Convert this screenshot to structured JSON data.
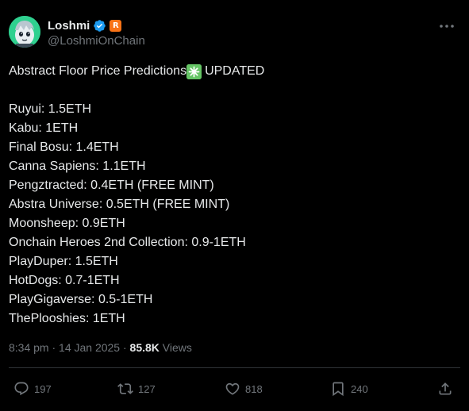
{
  "user": {
    "display_name": "Loshmi",
    "handle": "@LoshmiOnChain",
    "affiliate_letter": "R"
  },
  "post": {
    "headline_before": "Abstract Floor Price Predictions",
    "headline_after": "UPDATED",
    "lines": [
      "Ruyui: 1.5ETH",
      "Kabu: 1ETH",
      "Final Bosu: 1.4ETH",
      "Canna Sapiens: 1.1ETH",
      "Pengztracted: 0.4ETH (FREE MINT)",
      "Abstra Universe: 0.5ETH (FREE MINT)",
      "Moonsheep: 0.9ETH",
      "Onchain Heroes 2nd Collection: 0.9-1ETH",
      "PlayDuper: 1.5ETH",
      "HotDogs: 0.7-1ETH",
      "PlayGigaverse: 0.5-1ETH",
      "ThePlooshies: 1ETH"
    ],
    "timestamp": "8:34 pm · 14 Jan 2025 · ",
    "views_count": "85.8K",
    "views_label": "Views"
  },
  "actions": {
    "replies": "197",
    "reposts": "127",
    "likes": "818",
    "bookmarks": "240"
  },
  "colors": {
    "background": "#000000",
    "text": "#e7e9ea",
    "muted": "#71767b",
    "verified": "#1d9bf0",
    "affiliate": "#f97316",
    "sparkle": "#65c565"
  }
}
